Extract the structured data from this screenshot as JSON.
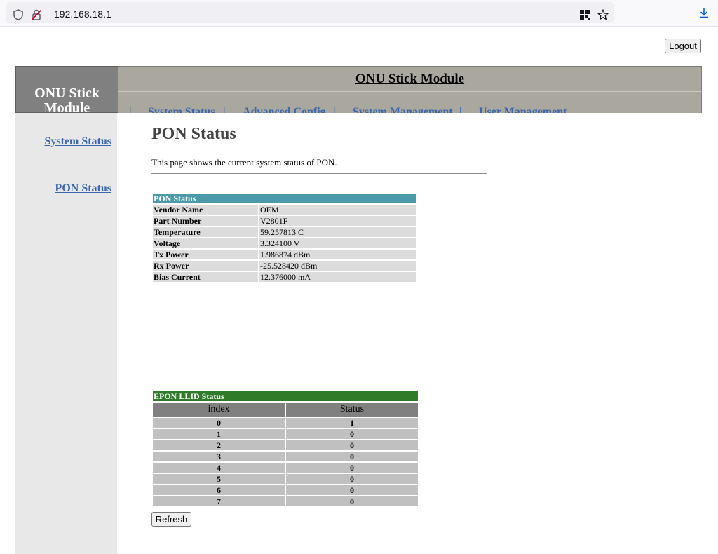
{
  "browser": {
    "url": "192.168.18.1"
  },
  "header": {
    "logout_label": "Logout",
    "logo_text": "ONU Stick Module",
    "title": "ONU Stick Module",
    "nav_separator": "|",
    "nav": [
      {
        "label": "System Status"
      },
      {
        "label": "Advanced Config"
      },
      {
        "label": "System Management"
      },
      {
        "label": "User Management"
      }
    ]
  },
  "sidebar": {
    "items": [
      {
        "label": "System Status"
      },
      {
        "label": "PON Status"
      }
    ]
  },
  "main": {
    "heading": "PON Status",
    "description": "This page shows the current system status of PON.",
    "pon_table": {
      "title": "PON Status",
      "rows": [
        {
          "label": "Vendor Name",
          "value": "OEM"
        },
        {
          "label": "Part Number",
          "value": "V2801F"
        },
        {
          "label": "Temperature",
          "value": "59.257813 C"
        },
        {
          "label": "Voltage",
          "value": "3.324100 V"
        },
        {
          "label": "Tx Power",
          "value": "1.986874 dBm"
        },
        {
          "label": "Rx Power",
          "value": "-25.528420 dBm"
        },
        {
          "label": "Bias Current",
          "value": "12.376000 mA"
        }
      ]
    },
    "llid_table": {
      "title": "EPON LLID Status",
      "columns": [
        "index",
        "Status"
      ],
      "rows": [
        [
          "0",
          "1"
        ],
        [
          "1",
          "0"
        ],
        [
          "2",
          "0"
        ],
        [
          "3",
          "0"
        ],
        [
          "4",
          "0"
        ],
        [
          "5",
          "0"
        ],
        [
          "6",
          "0"
        ],
        [
          "7",
          "0"
        ]
      ]
    },
    "refresh_label": "Refresh"
  }
}
